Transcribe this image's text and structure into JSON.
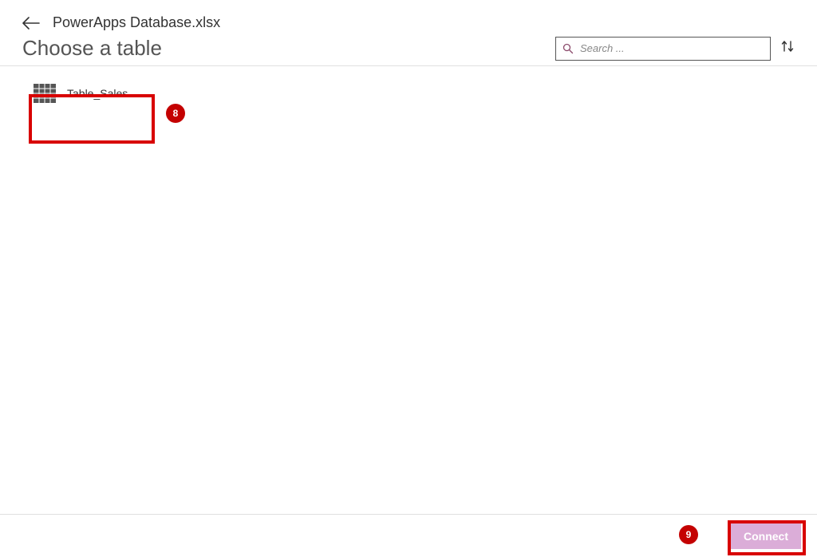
{
  "header": {
    "file_name": "PowerApps Database.xlsx"
  },
  "subheader": {
    "title": "Choose a table"
  },
  "search": {
    "placeholder": "Search ..."
  },
  "tables": {
    "items": [
      {
        "label": "Table_Sales"
      }
    ]
  },
  "footer": {
    "connect_label": "Connect"
  },
  "annotations": {
    "badge_8": "8",
    "badge_9": "9"
  }
}
